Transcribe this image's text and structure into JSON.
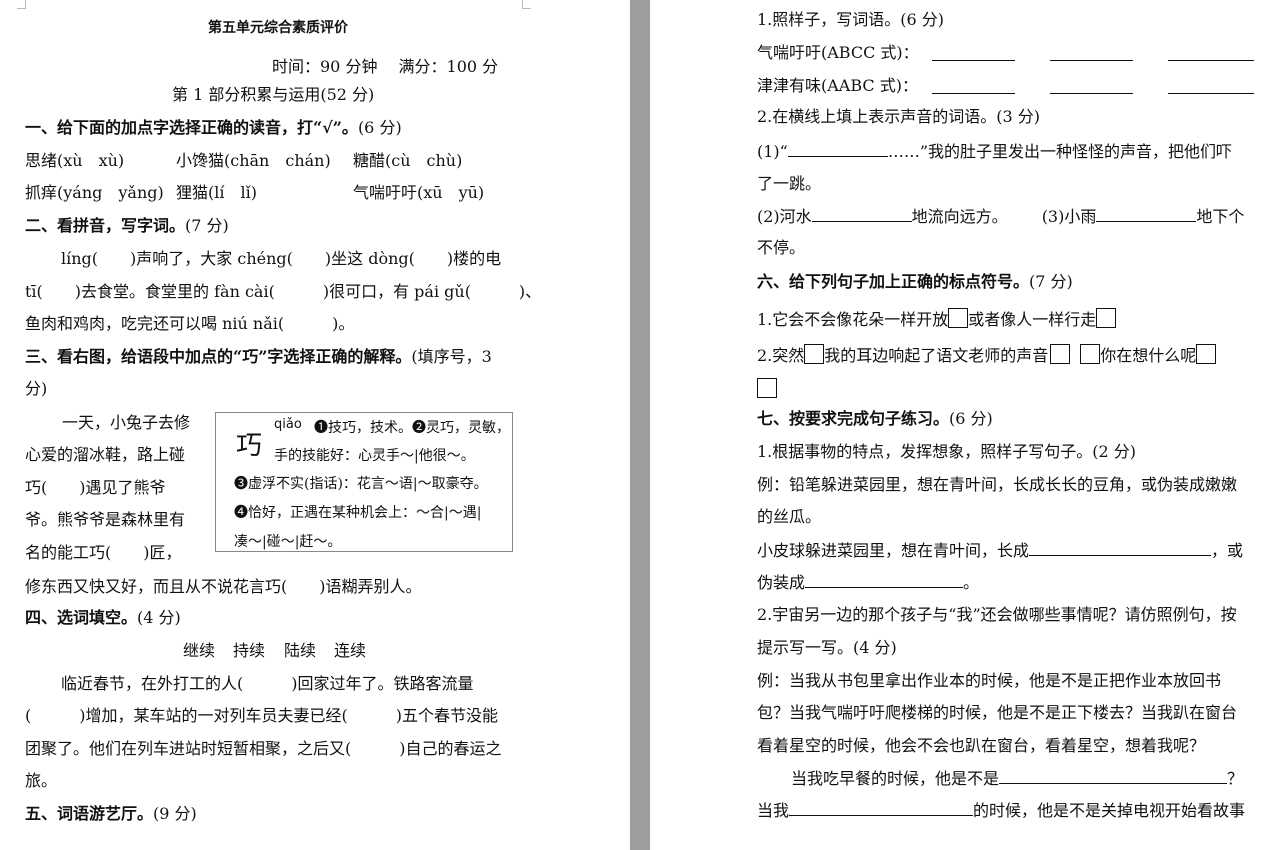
{
  "left": {
    "title": "第五单元综合素质评价",
    "time_line": "时间：90 分钟　 满分：100 分",
    "part1": "第 1 部分积累与运用(52 分)",
    "q1": {
      "heading": "一、给下面的加点字选择正确的读音，打“√”。",
      "score": "(6 分)",
      "row1": [
        "思绪(xù　xù)",
        "小馋猫(chān　chán)",
        "糖醋(cù　chù)"
      ],
      "row2": [
        "抓痒(yáng　yǎng)",
        "狸猫(lí　lǐ)",
        "气喘吁吁(xū　yū)"
      ]
    },
    "q2": {
      "heading": "二、看拼音，写字词。",
      "score": "(7 分)",
      "p1": "líng(　　)声响了，大家 chéng(　　)坐这 dòng(　　)楼的电",
      "p2": "tī(　　)去食堂。食堂里的 fàn cài(　　　)很可口，有 pái gǔ(　　　)、",
      "p3": "鱼肉和鸡肉，吃完还可以喝 niú nǎi(　　　)。"
    },
    "q3": {
      "heading": "三、看右图，给语段中加点的“巧”字选择正确的解释。",
      "note": "(填序号，3",
      "note2": "分)",
      "passage": [
        "一天，小兔子去修",
        "心爱的溜冰鞋，路上碰",
        "巧(　　)遇见了熊爷",
        "爷。熊爷爷是森林里有",
        "名的能工巧(　　)匠，"
      ],
      "last": "修东西又快又好，而且从不说花言巧(　　)语糊弄别人。",
      "dict": {
        "char": "巧",
        "pinyin": "qiǎo",
        "line1": "❶技巧，技术。❷灵巧，灵敏，",
        "line2": "手的技能好：心灵手～|他很～。",
        "line3": "❸虚浮不实(指话)：花言～语|～取豪夺。",
        "line4": "❹恰好，正遇在某种机会上：～合|～遇|",
        "line5": "凑～|碰～|赶～。"
      }
    },
    "q4": {
      "heading": "四、选词填空。",
      "score": "(4 分)",
      "words": [
        "继续",
        "持续",
        "陆续",
        "连续"
      ],
      "p1": "临近春节，在外打工的人(　　　)回家过年了。铁路客流量",
      "p2": "(　　　)增加，某车站的一对列车员夫妻已经(　　　)五个春节没能",
      "p3": "团聚了。他们在列车进站时短暂相聚，之后又(　　　)自己的春运之",
      "p4": "旅。"
    },
    "q5": {
      "heading": "五、词语游艺厅。",
      "score": "(9 分)"
    }
  },
  "right": {
    "s1": {
      "heading": "1.照样子，写词语。",
      "score": "(6 分)",
      "ex1": "气喘吁吁(ABCC 式)：",
      "ex2": "津津有味(AABC 式)："
    },
    "s2": {
      "heading": "2.在横线上填上表示声音的词语。",
      "score": "(3 分)",
      "l1a": "(1)“",
      "l1b": "……”我的肚子里发出一种怪怪的声音，把他们吓",
      "l2": "了一跳。",
      "l3a": "(2)河水",
      "l3b": "地流向远方。",
      "l3c": "(3)小雨",
      "l3d": "地下个",
      "l4": "不停。"
    },
    "q6": {
      "heading": "六、给下列句子加上正确的标点符号。",
      "score": "(7 分)",
      "s1a": "1.它会不会像花朵一样开放",
      "s1b": "或者像人一样行走",
      "s2a": "2.突然",
      "s2b": "我的耳边响起了语文老师的声音",
      "s2c": "你在想什么呢"
    },
    "q7": {
      "heading": "七、按要求完成句子练习。",
      "score": "(6 分)",
      "t1": "1.根据事物的特点，发挥想象，照样子写句子。",
      "t1score": "(2 分)",
      "ex1": "例：铅笔躲进菜园里，想在青叶间，长成长长的豆角，或伪装成嫩嫩",
      "ex2": "的丝瓜。",
      "q1a": "小皮球躲进菜园里，想在青叶间，长成",
      "q1b": "，或",
      "q2a": "伪装成",
      "q2b": "。",
      "t2": "2.宇宙另一边的那个孩子与“我”还会做哪些事情呢？请仿照例句，按",
      "t2b": "提示写一写。",
      "t2score": "(4 分)",
      "ex3": "例：当我从书包里拿出作业本的时候，他是不是正把作业本放回书",
      "ex4": "包？当我气喘吁吁爬楼梯的时候，他是不是正下楼去？当我趴在窗台",
      "ex5": "看着星空的时候，他会不会也趴在窗台，看着星空，想着我呢？",
      "w1a": "当我吃早餐的时候，他是不是",
      "w1b": "？",
      "w2a": "当我",
      "w2b": "的时候，他是不是关掉电视开始看故事"
    }
  }
}
